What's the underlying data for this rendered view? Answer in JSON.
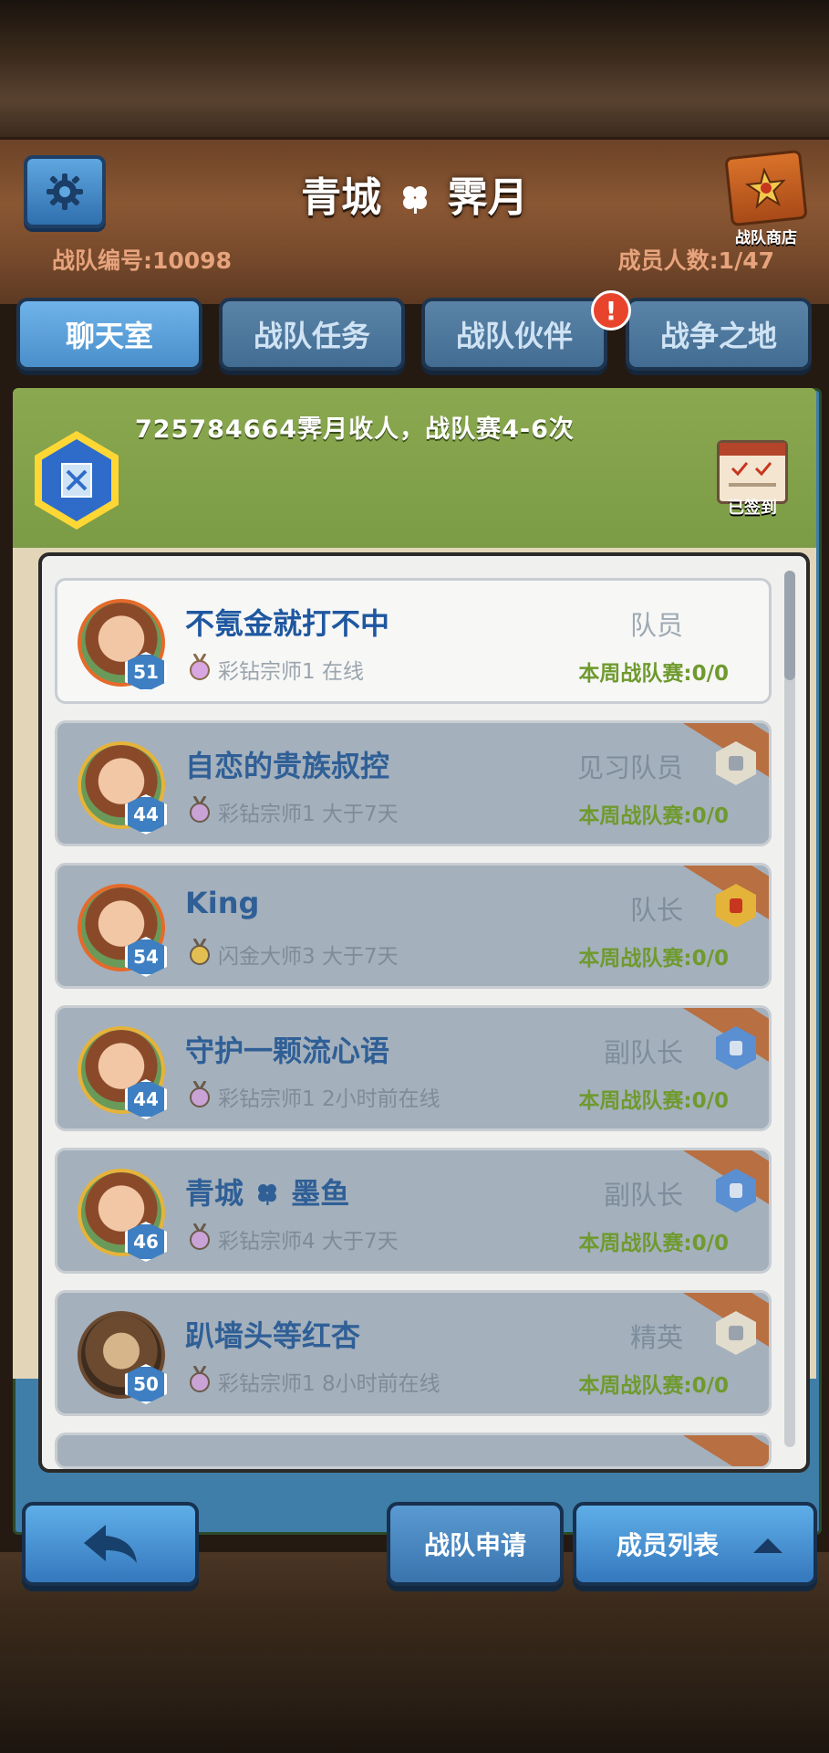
{
  "header": {
    "title": "青城",
    "title_suffix": "霁月",
    "shop_label": "战队商店",
    "team_id": "战队编号:10098",
    "member_count": "成员人数:1/47"
  },
  "tabs": [
    {
      "label": "聊天室",
      "active": true
    },
    {
      "label": "战队任务",
      "active": false
    },
    {
      "label": "战队伙伴",
      "active": false,
      "alert": "!"
    },
    {
      "label": "战争之地",
      "active": false
    }
  ],
  "announcement": "725784664霁月收人，战队赛4-6次",
  "checkin_label": "已签到",
  "members": [
    {
      "name": "不氪金就打不中",
      "level": "51",
      "rank": "彩钻宗师1 在线",
      "role": "队员",
      "weekly": "本周战队赛:0/0"
    },
    {
      "name": "自恋的贵族叔控",
      "level": "44",
      "rank": "彩钻宗师1 大于7天",
      "role": "见习队员",
      "weekly": "本周战队赛:0/0"
    },
    {
      "name": "King",
      "level": "54",
      "rank": "闪金大师3 大于7天",
      "role": "队长",
      "weekly": "本周战队赛:0/0"
    },
    {
      "name": "守护一颗流心语",
      "level": "44",
      "rank": "彩钻宗师1 2小时前在线",
      "role": "副队长",
      "weekly": "本周战队赛:0/0"
    },
    {
      "name": "青城",
      "name_suffix": "墨鱼",
      "level": "46",
      "rank": "彩钻宗师4 大于7天",
      "role": "副队长",
      "weekly": "本周战队赛:0/0"
    },
    {
      "name": "趴墙头等红杏",
      "level": "50",
      "rank": "彩钻宗师1 8小时前在线",
      "role": "精英",
      "weekly": "本周战队赛:0/0"
    }
  ],
  "bottom": {
    "apply_label": "战队申请",
    "members_label": "成员列表"
  },
  "icons": {
    "settings": "gear-icon",
    "back": "back-arrow-icon",
    "clover": "clover-icon"
  }
}
